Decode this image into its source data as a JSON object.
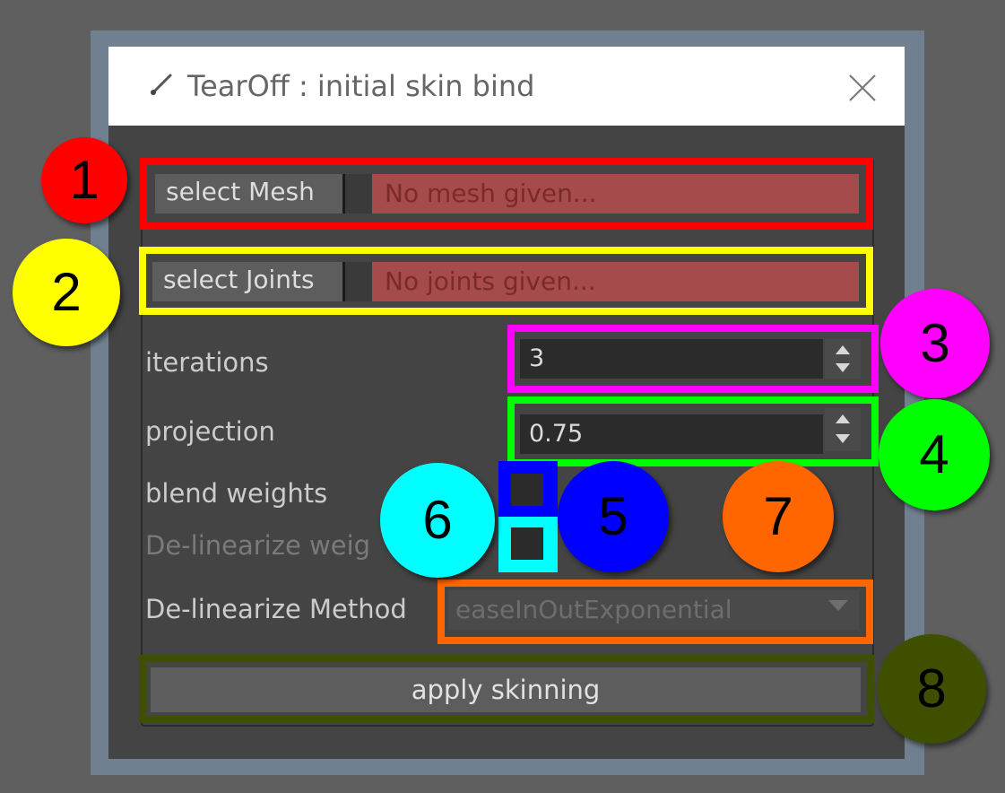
{
  "window": {
    "title": "TearOff : initial skin bind",
    "title_icon": "brush-icon",
    "close_icon": "close-icon"
  },
  "mesh_row": {
    "button_label": "select Mesh",
    "field_value": "No mesh given..."
  },
  "joints_row": {
    "button_label": "select Joints",
    "field_value": "No joints given..."
  },
  "iterations": {
    "label": "iterations",
    "value": "3"
  },
  "projection": {
    "label": "projection",
    "value": "0.75"
  },
  "blend_weights": {
    "label": "blend weights",
    "checked": false
  },
  "delinearize_weights": {
    "label": "De-linearize weig",
    "checked": false
  },
  "delinearize_method": {
    "label": "De-linearize Method",
    "value": "easeInOutExponential"
  },
  "apply_button": {
    "label": "apply skinning"
  },
  "annotations": [
    {
      "number": "1",
      "color": "#ff0000"
    },
    {
      "number": "2",
      "color": "#ffff00"
    },
    {
      "number": "3",
      "color": "#ff00ff"
    },
    {
      "number": "4",
      "color": "#00ff00"
    },
    {
      "number": "5",
      "color": "#0000ff"
    },
    {
      "number": "6",
      "color": "#00ffff"
    },
    {
      "number": "7",
      "color": "#ff6600"
    },
    {
      "number": "8",
      "color": "#3f4f00"
    }
  ],
  "colors": {
    "background": "#5f5f5f",
    "window_frame": "#708090",
    "panel": "#444444",
    "error_field": "#a54b4b"
  }
}
